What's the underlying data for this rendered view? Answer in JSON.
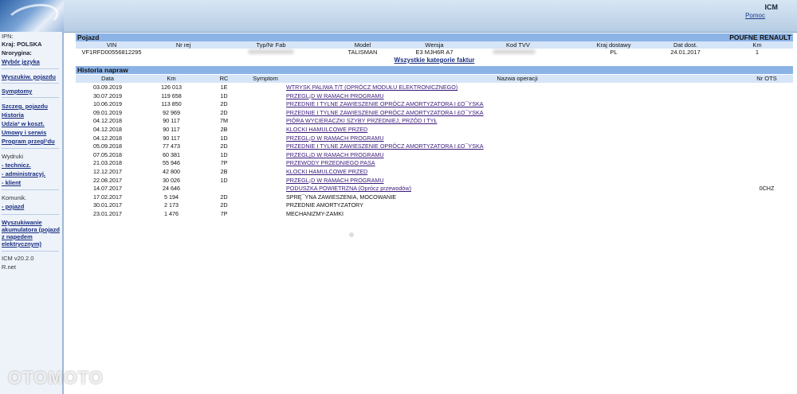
{
  "header": {
    "title": "ICM",
    "help_label": "Pomoc"
  },
  "sidebar": {
    "ipn_label": "IPN:",
    "country": "Kraj: POLSKA",
    "nroryg": "Nroryginа:",
    "lang": "Wybór języka",
    "search_vehicle": "Wyszukiw. pojazdu",
    "symptoms": "Symptomy",
    "vehicle_detail": "Szczeg. pojazdu",
    "history": "Historia",
    "share": "Udzia³ w koszt.",
    "contracts": "Umowy i serwis",
    "program": "Program przegl¹du",
    "prints": "Wydruki",
    "print_tech": "- technicz.",
    "print_admin": "- administracyj.",
    "print_client": "- klient",
    "comm": "Komunik.",
    "comm_vehicle": "- pojazd",
    "battery_search_1": "Wyszukiwanie",
    "battery_search_2": "akumulatora (pojazd",
    "battery_search_3": "z napędem",
    "battery_search_4": "elektrycznym)",
    "version": "ICM v20.2.0",
    "rnet": "R.net"
  },
  "vehicle": {
    "section_title": "Pojazd",
    "confidential": "POUFNE RENAULT",
    "headers": {
      "vin": "VIN",
      "nr_rej": "Nr rej",
      "typ": "Typ/Nr Fab",
      "model": "Model",
      "wersja": "Wersja",
      "kod_tvv": "Kod TVV",
      "kraj": "Kraj dostawy",
      "data": "Dat dost.",
      "km": "Km"
    },
    "values": {
      "vin": "VF1RFD00556812295",
      "model": "TALISMAN",
      "wersja": "E3 MJH6R A7",
      "kraj": "PL",
      "data": "24.01.2017",
      "km": "1"
    },
    "all_categories": "Wszystkie kategorie faktur"
  },
  "history": {
    "section_title": "Historia napraw",
    "headers": {
      "date": "Data",
      "km": "Km",
      "rc": "RC",
      "symptom": "Symptom",
      "operation": "Nazwa operacji",
      "ots": "Nr OTS"
    },
    "rows": [
      {
        "date": "03.09.2019",
        "km": "126 013",
        "rc": "1E",
        "op": "WTRYSK PALIWA T/T (OPRÓCZ MODUŁU ELEKTRONICZNEGO)",
        "ots": ""
      },
      {
        "date": "30.07.2019",
        "km": "119 658",
        "rc": "1D",
        "op": "PRZEGL¡D W RAMACH PROGRAMU",
        "ots": ""
      },
      {
        "date": "10.06.2019",
        "km": "113 850",
        "rc": "2D",
        "op": "PRZEDNIE I TYLNE ZAWIESZENIE OPRÓCZ AMORTYZATORA I £O¯YSKA",
        "ots": ""
      },
      {
        "date": "09.01.2019",
        "km": "92 969",
        "rc": "2D",
        "op": "PRZEDNIE I TYLNE ZAWIESZENIE OPRÓCZ AMORTYZATORA I £O¯YSKA",
        "ots": ""
      },
      {
        "date": "04.12.2018",
        "km": "90 117",
        "rc": "7M",
        "op": "PIÓRA WYCIERACZKI SZYBY PRZEDNIEJ, PRZÓD I TYŁ",
        "ots": ""
      },
      {
        "date": "04.12.2018",
        "km": "90 117",
        "rc": "2B",
        "op": "KLOCKI HAMULCOWE PRZED",
        "ots": ""
      },
      {
        "date": "04.12.2018",
        "km": "90 117",
        "rc": "1D",
        "op": "PRZEGL¡D W RAMACH PROGRAMU",
        "ots": ""
      },
      {
        "date": "05.09.2018",
        "km": "77 473",
        "rc": "2D",
        "op": "PRZEDNIE I TYLNE ZAWIESZENIE OPRÓCZ AMORTYZATORA I £O¯YSKA",
        "ots": ""
      },
      {
        "date": "07.05.2018",
        "km": "60 381",
        "rc": "1D",
        "op": "PRZEGL¡D W RAMACH PROGRAMU",
        "ots": ""
      },
      {
        "date": "21.03.2018",
        "km": "55 946",
        "rc": "7P",
        "op": "PRZEWODY PRZEDNIEGO PASA",
        "ots": ""
      },
      {
        "date": "12.12.2017",
        "km": "42 800",
        "rc": "2B",
        "op": "KLOCKI HAMULCOWE PRZED",
        "ots": ""
      },
      {
        "date": "22.08.2017",
        "km": "30 026",
        "rc": "1D",
        "op": "PRZEGL¡D W RAMACH PROGRAMU",
        "ots": ""
      },
      {
        "date": "14.07.2017",
        "km": "24 646",
        "rc": "",
        "op": "PODUSZKA POWIETRZNA (Oprócz przewodów)",
        "ots": "0CHZ"
      },
      {
        "date": "17.02.2017",
        "km": "5 194",
        "rc": "2D",
        "op": "SPRĘ¯YNA ZAWIESZENIA, MOCOWANIE",
        "ots": "",
        "plain": true
      },
      {
        "date": "30.01.2017",
        "km": "2 173",
        "rc": "2D",
        "op": "PRZEDNIE AMORTYZATORY",
        "ots": "",
        "plain": true
      },
      {
        "date": "23.01.2017",
        "km": "1 476",
        "rc": "7P",
        "op": "MECHANIZMY-ZAMKI",
        "ots": "",
        "plain": true
      }
    ]
  },
  "watermark": "OTOMOTO"
}
